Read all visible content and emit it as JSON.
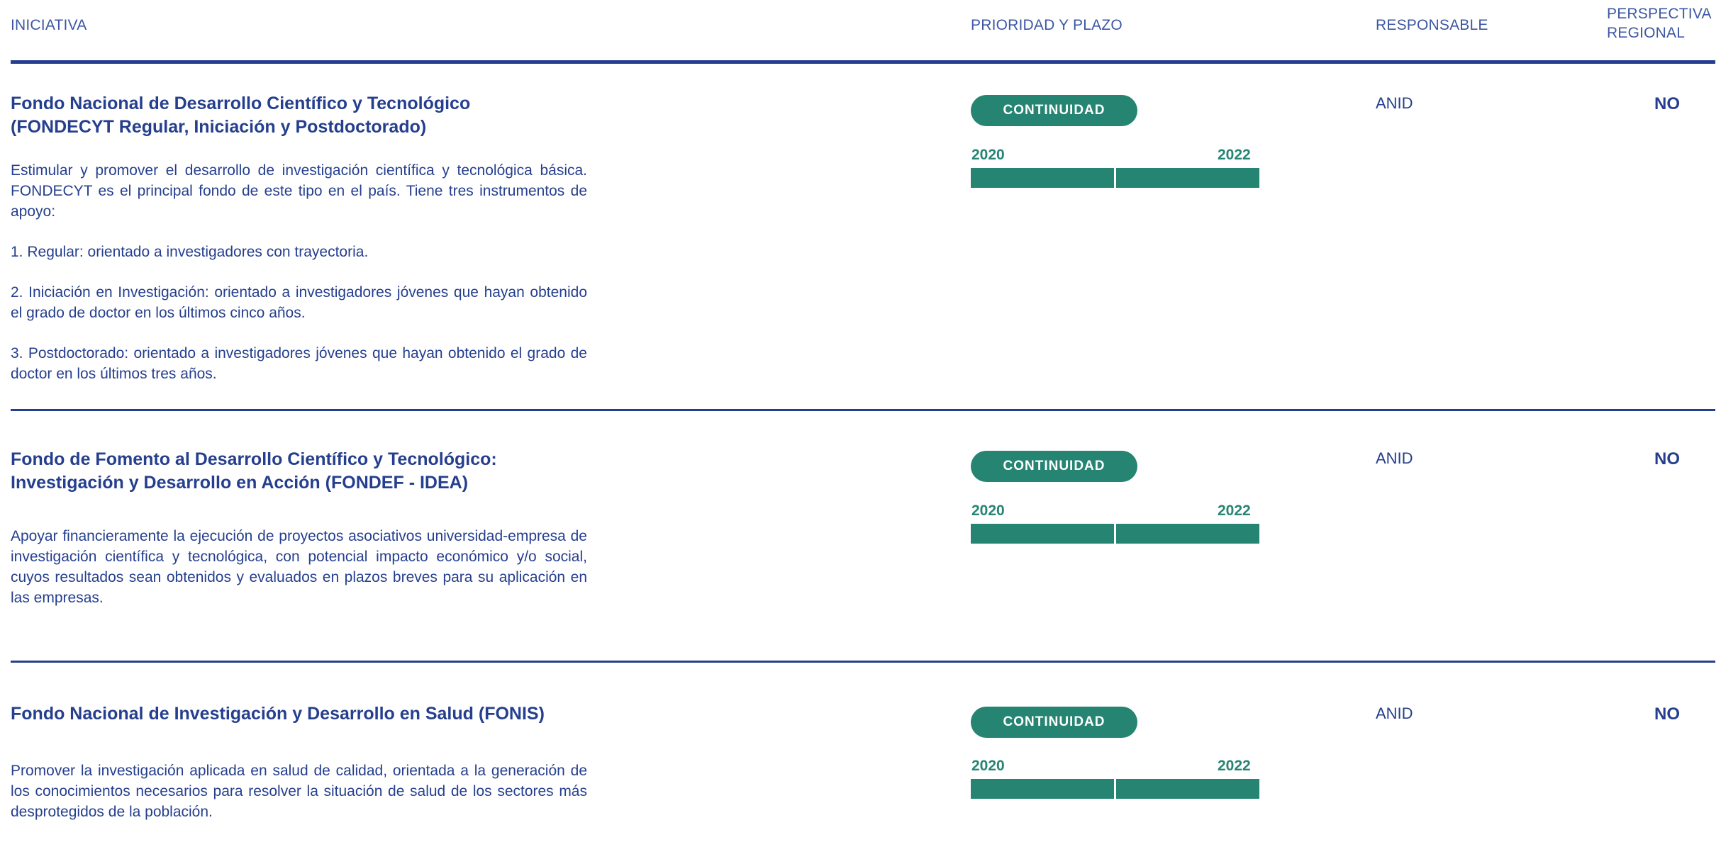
{
  "header": {
    "iniciativa": "INICIATIVA",
    "prioridad": "PRIORIDAD Y PLAZO",
    "responsable": "RESPONSABLE",
    "perspectiva_line1": "PERSPECTIVA",
    "perspectiva_line2": "REGIONAL"
  },
  "colors": {
    "primary": "#253f8e",
    "accent": "#258472"
  },
  "rows": [
    {
      "title_line1": "Fondo Nacional de Desarrollo Científico y Tecnológico",
      "title_line2": "(FONDECYT Regular, Iniciación y Postdoctorado)",
      "desc": [
        "Estimular y promover el desarrollo de investigación científica y tecnológica básica. FONDECYT es el principal fondo de este tipo en el país. Tiene tres instrumentos de apoyo:",
        "1. Regular: orientado a investigadores con trayectoria.",
        "2. Iniciación en Investigación: orientado a investigadores jóvenes que hayan obtenido el grado de doctor en los últimos cinco años.",
        "3. Postdoctorado: orientado a investigadores jóvenes que hayan obtenido el grado de doctor en los últimos tres años."
      ],
      "priority": "CONTINUIDAD",
      "start_year": "2020",
      "end_year": "2022",
      "responsible": "ANID",
      "regional": "NO"
    },
    {
      "title_line1": "Fondo de Fomento al Desarrollo Científico y Tecnológico:",
      "title_line2": "Investigación y Desarrollo en Acción (FONDEF - IDEA)",
      "desc": [
        "Apoyar financieramente la ejecución de proyectos asociativos universidad-empresa de investigación científica y tecnológica, con potencial impacto económico y/o social, cuyos resultados sean obtenidos y evaluados en plazos breves para su aplicación en las empresas."
      ],
      "priority": "CONTINUIDAD",
      "start_year": "2020",
      "end_year": "2022",
      "responsible": "ANID",
      "regional": "NO"
    },
    {
      "title_line1": "Fondo Nacional de Investigación y Desarrollo en Salud (FONIS)",
      "desc": [
        "Promover la investigación aplicada en salud de calidad, orientada a la generación de los conocimientos necesarios para resolver la situación de salud de los sectores más desprotegidos de la población."
      ],
      "priority": "CONTINUIDAD",
      "start_year": "2020",
      "end_year": "2022",
      "responsible": "ANID",
      "regional": "NO"
    }
  ]
}
